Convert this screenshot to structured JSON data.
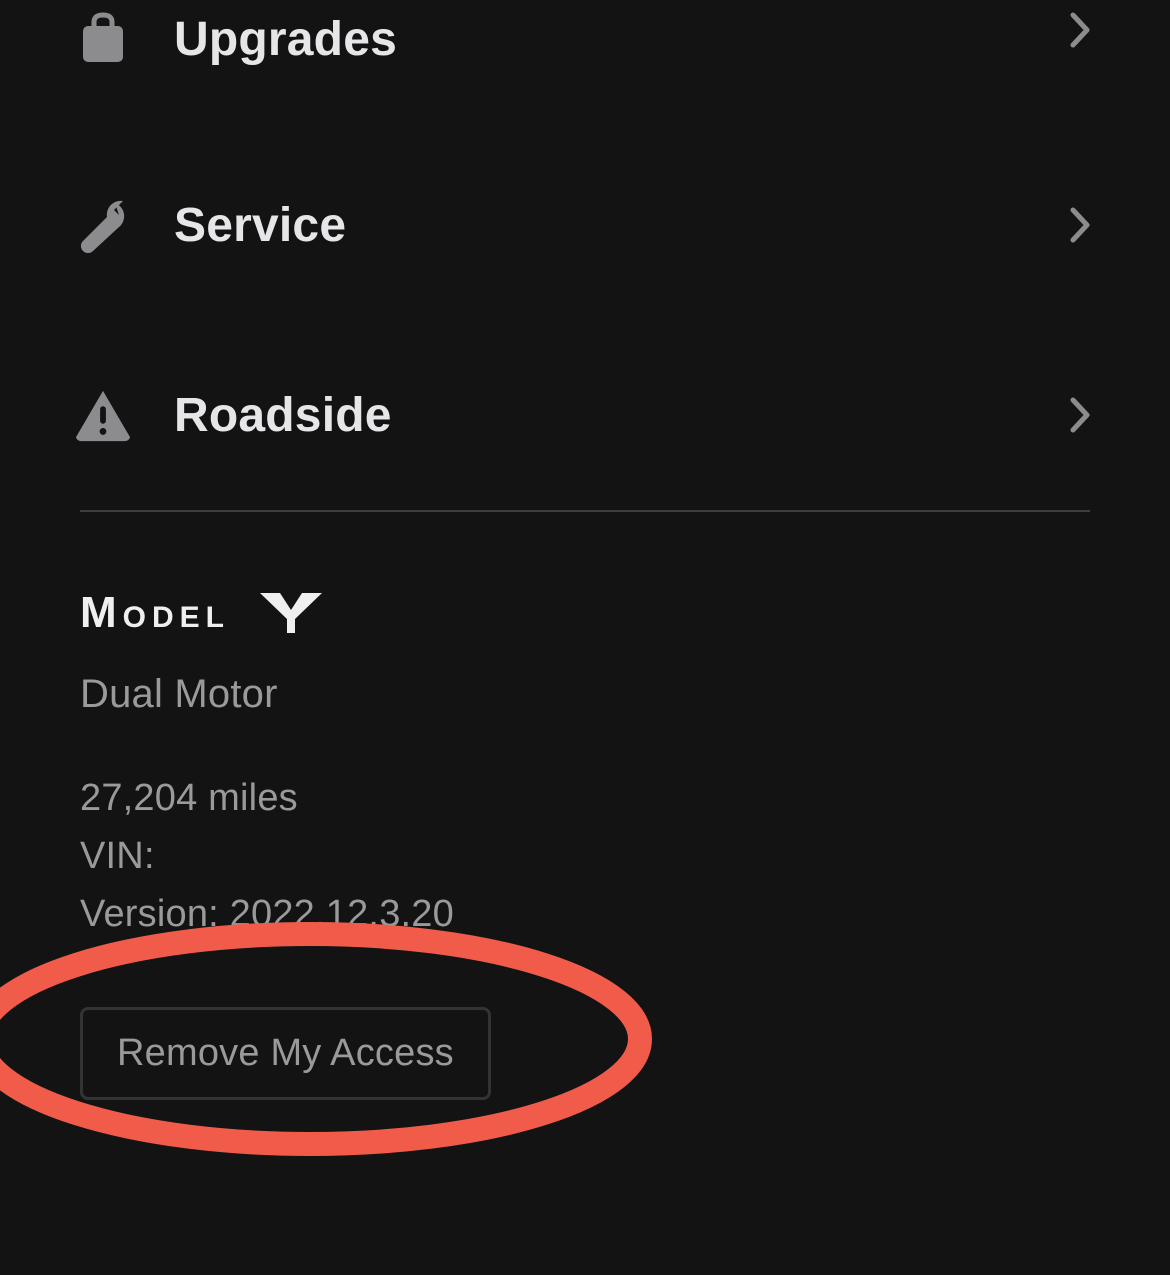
{
  "menu": {
    "items": [
      {
        "label": "Upgrades",
        "icon": "bag-icon"
      },
      {
        "label": "Service",
        "icon": "wrench-icon"
      },
      {
        "label": "Roadside",
        "icon": "warning-triangle-icon"
      }
    ]
  },
  "vehicle": {
    "model_word1": "MODEL",
    "model_word2_alt": "Y",
    "drivetrain": "Dual Motor",
    "odometer": "27,204 miles",
    "vin_label": "VIN:",
    "vin_value": "",
    "version_prefix": "Version: ",
    "version": "2022.12.3.20"
  },
  "actions": {
    "remove_access_label": "Remove My Access"
  },
  "colors": {
    "background": "#131314",
    "text_primary": "#e6e6e8",
    "text_secondary": "#9a9a9c",
    "icon": "#8c8c8e",
    "divider": "#3e3e40",
    "annotation": "#f15c4a"
  }
}
